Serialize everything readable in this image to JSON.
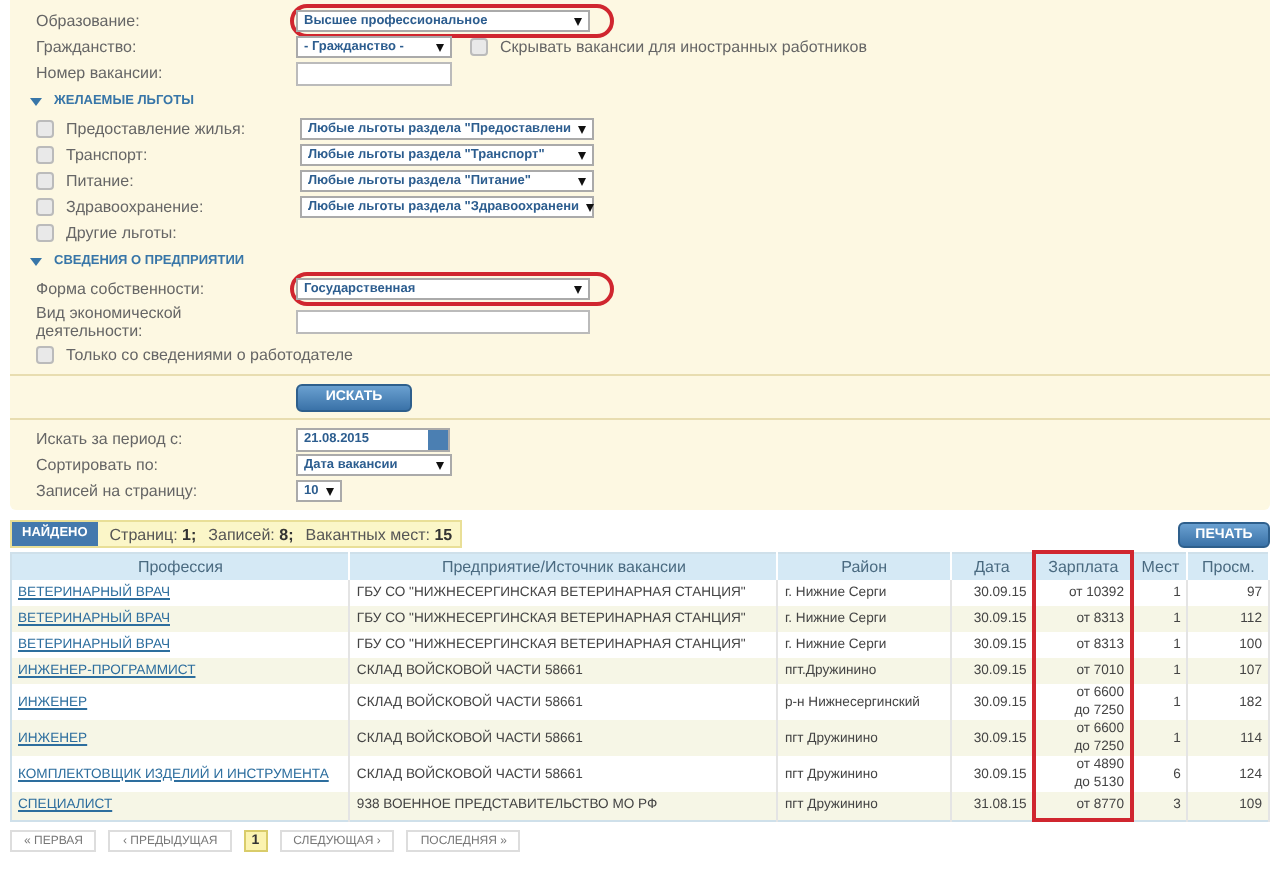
{
  "form_rows": [
    {
      "kind": "select",
      "label": "Образование:",
      "value": "Высшее профессиональное",
      "highlighted": true
    },
    {
      "kind": "select",
      "label": "Гражданство:",
      "value": "- Гражданство -",
      "highlighted": false,
      "option": {
        "label": "Скрывать вакансии для иностранных работников",
        "checked": false
      }
    },
    {
      "kind": "input",
      "label": "Номер вакансии:"
    },
    {
      "kind": "section",
      "label": "ЖЕЛАЕМЫЕ ЛЬГОТЫ",
      "expanded": true
    },
    {
      "kind": "checkbox_select",
      "label": "Предоставление жилья:",
      "checked": false,
      "value": "Любые льготы раздела \"Предоставлени"
    },
    {
      "kind": "checkbox_select",
      "label": "Транспорт:",
      "checked": false,
      "value": "Любые льготы раздела \"Транспорт\""
    },
    {
      "kind": "checkbox_select",
      "label": "Питание:",
      "checked": false,
      "value": "Любые льготы раздела \"Питание\""
    },
    {
      "kind": "checkbox_select",
      "label": "Здравоохранение:",
      "checked": false,
      "value": "Любые льготы раздела \"Здравоохранени"
    },
    {
      "kind": "checkbox",
      "label": "Другие льготы:",
      "checked": false
    },
    {
      "kind": "section",
      "label": "СВЕДЕНИЯ О ПРЕДПРИЯТИИ",
      "expanded": true
    },
    {
      "kind": "select",
      "label": "Форма собственности:",
      "value": "Государственная",
      "highlighted": true
    },
    {
      "kind": "input",
      "label": "Вид экономической деятельности:"
    },
    {
      "kind": "checkbox",
      "label": "Только со сведениями о работодателе",
      "checked": false
    },
    {
      "kind": "button",
      "label": "ИСКАТЬ"
    },
    {
      "kind": "date",
      "label": "Искать за период с:",
      "value": "21.08.2015"
    },
    {
      "kind": "select",
      "label": "Сортировать по:",
      "value": "Дата вакансии",
      "highlighted": false
    },
    {
      "kind": "select",
      "label": "Записей на страницу:",
      "value": "10",
      "highlighted": false
    }
  ],
  "summary": {
    "badge": "НАЙДЕНО",
    "items": [
      {
        "label": "Страниц:",
        "value": "1;"
      },
      {
        "label": "Записей:",
        "value": "8;"
      },
      {
        "label": "Вакантных мест:",
        "value": "15"
      }
    ]
  },
  "print_button": "ПЕЧАТЬ",
  "table": {
    "columns": [
      {
        "label": "Профессия",
        "highlighted": false
      },
      {
        "label": "Предприятие/Источник вакансии",
        "highlighted": false
      },
      {
        "label": "Район",
        "highlighted": false
      },
      {
        "label": "Дата",
        "highlighted": false
      },
      {
        "label": "Зарплата",
        "highlighted": true
      },
      {
        "label": "Мест",
        "highlighted": false
      },
      {
        "label": "Просм.",
        "highlighted": false
      }
    ],
    "rows": [
      {
        "profession": "ВЕТЕРИНАРНЫЙ ВРАЧ",
        "company": "ГБУ СО \"НИЖНЕСЕРГИНСКАЯ ВЕТЕРИНАРНАЯ СТАНЦИЯ\"",
        "district": "г. Нижние Серги",
        "date": "30.09.15",
        "salary": [
          "от 10392"
        ],
        "places": "1",
        "views": "97"
      },
      {
        "profession": "ВЕТЕРИНАРНЫЙ ВРАЧ",
        "company": "ГБУ СО \"НИЖНЕСЕРГИНСКАЯ ВЕТЕРИНАРНАЯ СТАНЦИЯ\"",
        "district": "г. Нижние Серги",
        "date": "30.09.15",
        "salary": [
          "от 8313"
        ],
        "places": "1",
        "views": "112"
      },
      {
        "profession": "ВЕТЕРИНАРНЫЙ ВРАЧ",
        "company": "ГБУ СО \"НИЖНЕСЕРГИНСКАЯ ВЕТЕРИНАРНАЯ СТАНЦИЯ\"",
        "district": "г. Нижние Серги",
        "date": "30.09.15",
        "salary": [
          "от 8313"
        ],
        "places": "1",
        "views": "100"
      },
      {
        "profession": "ИНЖЕНЕР-ПРОГРАММИСТ",
        "company": "СКЛАД ВОЙСКОВОЙ ЧАСТИ 58661",
        "district": "пгт.Дружинино",
        "date": "30.09.15",
        "salary": [
          "от 7010"
        ],
        "places": "1",
        "views": "107"
      },
      {
        "profession": "ИНЖЕНЕР",
        "company": "СКЛАД ВОЙСКОВОЙ ЧАСТИ 58661",
        "district": "р-н Нижнесергинский",
        "date": "30.09.15",
        "salary": [
          "от 6600",
          "до 7250"
        ],
        "places": "1",
        "views": "182"
      },
      {
        "profession": "ИНЖЕНЕР",
        "company": "СКЛАД ВОЙСКОВОЙ ЧАСТИ 58661",
        "district": "пгт Дружинино",
        "date": "30.09.15",
        "salary": [
          "от 6600",
          "до 7250"
        ],
        "places": "1",
        "views": "114"
      },
      {
        "profession": "КОМПЛЕКТОВЩИК ИЗДЕЛИЙ И ИНСТРУМЕНТА",
        "company": "СКЛАД ВОЙСКОВОЙ ЧАСТИ 58661",
        "district": "пгт Дружинино",
        "date": "30.09.15",
        "salary": [
          "от 4890",
          "до 5130"
        ],
        "places": "6",
        "views": "124"
      },
      {
        "profession": "СПЕЦИАЛИСТ",
        "company": "938 ВОЕННОЕ ПРЕДСТАВИТЕЛЬСТВО МО РФ",
        "district": "пгт Дружинино",
        "date": "31.08.15",
        "salary": [
          "от 8770"
        ],
        "places": "3",
        "views": "109"
      }
    ]
  },
  "pagination": [
    {
      "kind": "nav",
      "label": "« ПЕРВАЯ",
      "selected": false
    },
    {
      "kind": "nav",
      "label": "‹ ПРЕДЫДУЩАЯ",
      "selected": false
    },
    {
      "kind": "page",
      "label": "1",
      "selected": true
    },
    {
      "kind": "nav",
      "label": "СЛЕДУЮЩАЯ ›",
      "selected": false
    },
    {
      "kind": "nav",
      "label": "ПОСЛЕДНЯЯ »",
      "selected": false
    }
  ]
}
